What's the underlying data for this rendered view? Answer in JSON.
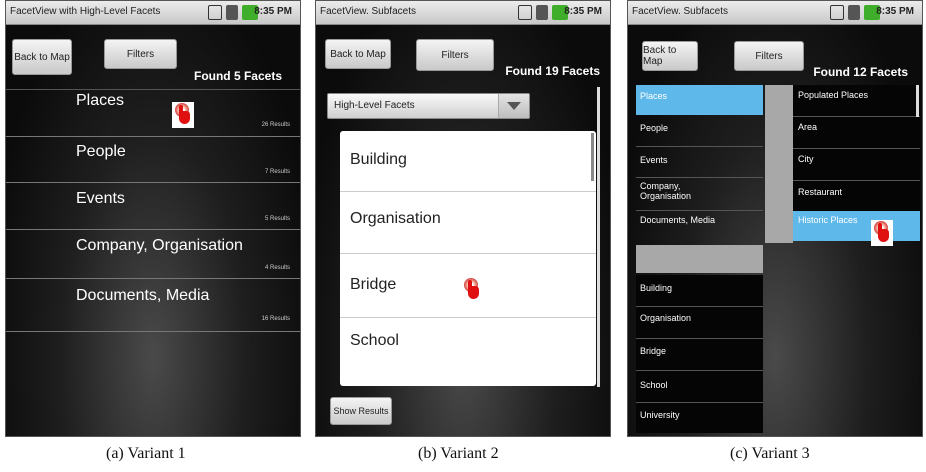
{
  "panel1": {
    "title": "FacetView with High-Level Facets",
    "time": "8:35 PM",
    "back_label": "Back to Map",
    "filters_label": "Filters",
    "found": "Found 5 Facets",
    "facets": [
      {
        "name": "Places",
        "count": "26 Results"
      },
      {
        "name": "People",
        "count": "7 Results"
      },
      {
        "name": "Events",
        "count": "5 Results"
      },
      {
        "name": "Company, Organisation",
        "count": "4 Results"
      },
      {
        "name": "Documents, Media",
        "count": "16 Results"
      }
    ]
  },
  "panel2": {
    "title": "FacetView. Subfacets",
    "time": "8:35 PM",
    "back_label": "Back to Map",
    "filters_label": "Filters",
    "found": "Found 19 Facets",
    "dropdown": "High-Level Facets",
    "items": [
      "Building",
      "Organisation",
      "Bridge",
      "School"
    ],
    "show_results": "Show Results"
  },
  "panel3": {
    "title": "FacetView. Subfacets",
    "time": "8:35 PM",
    "back_label": "Back to Map",
    "filters_label": "Filters",
    "found": "Found 12 Facets",
    "left_items": [
      "Places",
      "People",
      "Events",
      "Company, Organisation",
      "Documents, Media"
    ],
    "bottom_items": [
      "Building",
      "Organisation",
      "Bridge",
      "School",
      "University"
    ],
    "right_items": [
      "Populated Places",
      "Area",
      "City",
      "Restaurant",
      "Historic Places"
    ]
  },
  "captions": [
    "(a) Variant 1",
    "(b) Variant 2",
    "(c) Variant 3"
  ],
  "colors": {
    "selected": "#5fb8ea",
    "status_icon_green": "#3fae2a"
  }
}
